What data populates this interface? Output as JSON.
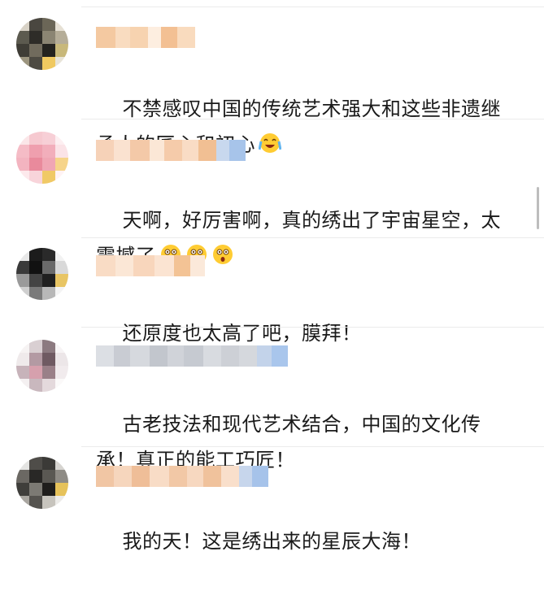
{
  "comments": [
    {
      "text": "不禁感叹中国的传统艺术强大和这些非遗继承人的匠心和初心",
      "emoji": [
        "crying-laugh"
      ]
    },
    {
      "text": "天啊，好厉害啊，真的绣出了宇宙星空，太震撼了",
      "emoji": [
        "astonished",
        "astonished",
        "astonished"
      ]
    },
    {
      "text": "还原度也太高了吧，膜拜！",
      "emoji": []
    },
    {
      "text": "古老技法和现代艺术结合，中国的文化传承！真正的能工巧匠！",
      "emoji": []
    },
    {
      "text": "我的天！这是绣出来的星辰大海！",
      "emoji": []
    }
  ],
  "colors": {
    "text": "#1a1a1a",
    "divider": "#ebebeb",
    "blurred_name": "#f2c9a3",
    "blurred_name_alt": "#a9c6ea",
    "scrollbar": "#bdbdbd"
  }
}
